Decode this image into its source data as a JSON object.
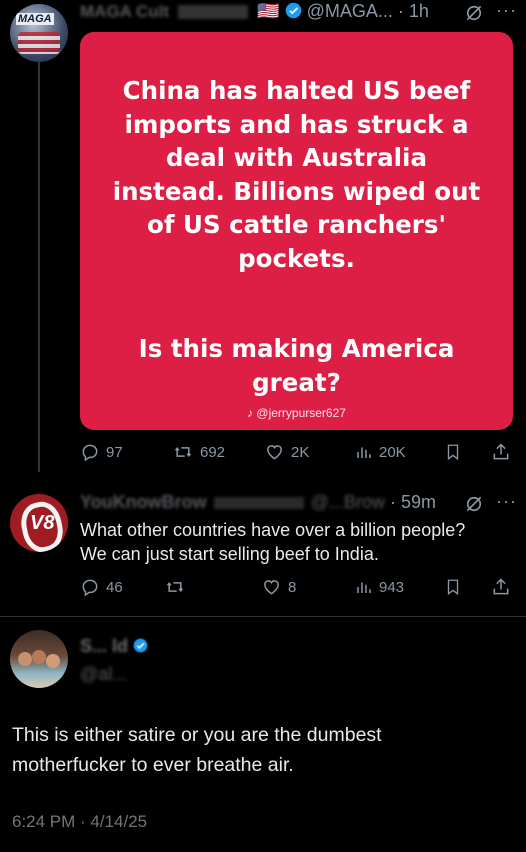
{
  "post": {
    "display_name": "MAGA Cult",
    "handle": "@MAGA...",
    "time": "1h",
    "avatar_text": "MAGA",
    "flag": "🇺🇸",
    "card_lines": [
      "China has halted US beef",
      "imports and has struck a",
      "deal with Australia",
      "instead. Billions wiped out",
      "of US cattle ranchers'",
      "pockets."
    ],
    "card_question_lines": [
      "Is this making America",
      "great?"
    ],
    "card_credit": "@jerrypurser627",
    "stats": {
      "replies": "97",
      "reposts": "692",
      "likes": "2K",
      "views": "20K"
    }
  },
  "reply": {
    "display_name": "YouKnowBrow",
    "handle": "@...Brow",
    "time": "59m",
    "avatar_text": "V8",
    "text_lines": [
      "What other countries have over a billion people?",
      "We can just start selling beef to India."
    ],
    "stats": {
      "replies": "46",
      "reposts": "",
      "likes": "8",
      "views": "943"
    }
  },
  "quote": {
    "display_name": "S... ld",
    "handle": "@al...",
    "text_lines": [
      "This is either satire or you are the dumbest",
      "motherfucker to ever breathe air."
    ],
    "timestamp": "6:24 PM · 4/14/25"
  },
  "colors": {
    "card": "#dd1f45",
    "verified": "#1d9bf0",
    "muted": "#8b98a5",
    "background": "#000000"
  }
}
